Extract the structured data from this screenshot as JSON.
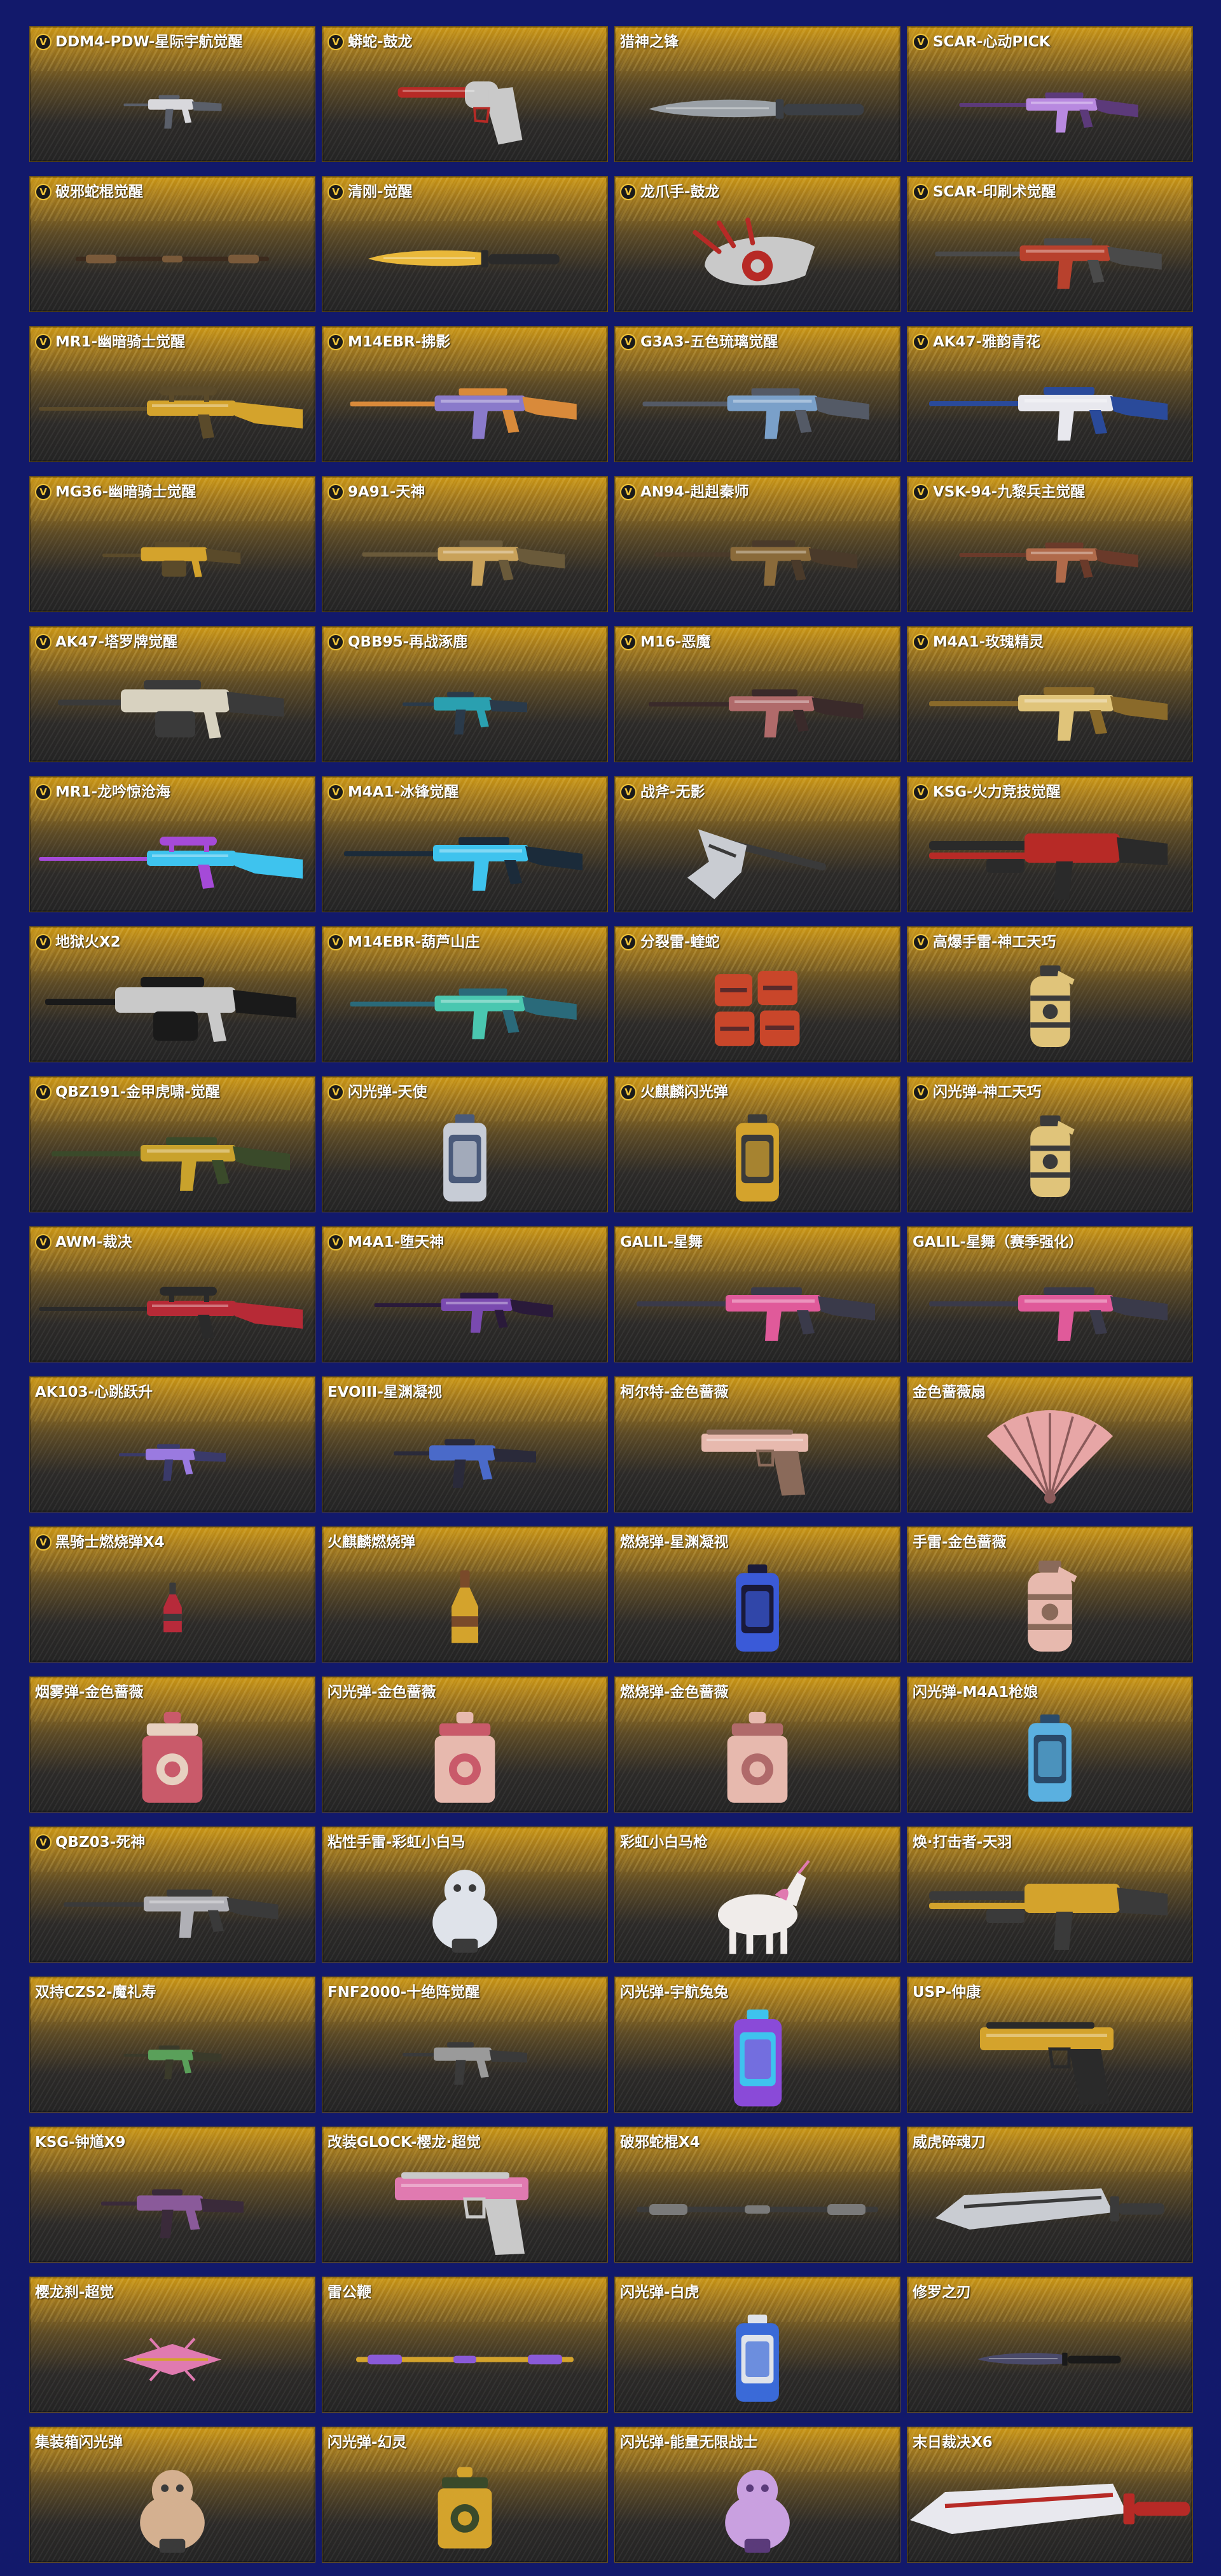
{
  "badge_label": "V",
  "items": [
    {
      "name": "DDM4-PDW-星际宇航觉醒",
      "v": true,
      "icon": "smg-icon",
      "c1": "#d8d8dc",
      "c2": "#5a5f6a",
      "s": 0.55
    },
    {
      "name": "蟒蛇-鼓龙",
      "v": true,
      "icon": "revolver-icon",
      "c1": "#b72a26",
      "c2": "#c9c9c9",
      "s": 0.8
    },
    {
      "name": "猎神之锋",
      "v": false,
      "icon": "knife-icon",
      "c1": "#9aa0a6",
      "c2": "#3b3f45",
      "s": 0.9
    },
    {
      "name": "SCAR-心动PICK",
      "v": true,
      "icon": "rifle-icon",
      "c1": "#b889e0",
      "c2": "#5c3a7a",
      "s": 0.75
    },
    {
      "name": "破邪蛇棍觉醒",
      "v": true,
      "icon": "staff-icon",
      "c1": "#7a5a3a",
      "c2": "#3b2a1d",
      "s": 0.8
    },
    {
      "name": "清刚-觉醒",
      "v": true,
      "icon": "knife-icon",
      "c1": "#e9b83a",
      "c2": "#2a2a2a",
      "s": 0.8
    },
    {
      "name": "龙爪手-鼓龙",
      "v": true,
      "icon": "claw-icon",
      "c1": "#b72a26",
      "c2": "#c9c9c9",
      "s": 0.8
    },
    {
      "name": "SCAR-印刷术觉醒",
      "v": true,
      "icon": "rifle-icon",
      "c1": "#b8412d",
      "c2": "#4a4a4a",
      "s": 0.95
    },
    {
      "name": "MR1-幽暗骑士觉醒",
      "v": true,
      "icon": "sniper-icon",
      "c1": "#d4a32c",
      "c2": "#5a4a2a",
      "s": 1.0
    },
    {
      "name": "M14EBR-拂影",
      "v": true,
      "icon": "rifle-icon",
      "c1": "#8a7acb",
      "c2": "#d98a3a",
      "s": 0.95
    },
    {
      "name": "G3A3-五色琉璃觉醒",
      "v": true,
      "icon": "rifle-icon",
      "c1": "#7aa0c9",
      "c2": "#545a66",
      "s": 0.95
    },
    {
      "name": "AK47-雅韵青花",
      "v": true,
      "icon": "rifle-icon",
      "c1": "#e8e8ee",
      "c2": "#2a4a9a",
      "s": 1.0
    },
    {
      "name": "MG36-幽暗骑士觉醒",
      "v": true,
      "icon": "mg-icon",
      "c1": "#d4a32c",
      "c2": "#5a4a2a",
      "s": 0.55
    },
    {
      "name": "9A91-天神",
      "v": true,
      "icon": "rifle-icon",
      "c1": "#c9a25a",
      "c2": "#6a5a3a",
      "s": 0.85
    },
    {
      "name": "AN94-赳赳秦师",
      "v": true,
      "icon": "rifle-icon",
      "c1": "#8a6a3a",
      "c2": "#4a3a2a",
      "s": 0.85
    },
    {
      "name": "VSK-94-九黎兵主觉醒",
      "v": true,
      "icon": "rifle-icon",
      "c1": "#b06a4a",
      "c2": "#6a3a2a",
      "s": 0.75
    },
    {
      "name": "AK47-塔罗牌觉醒",
      "v": true,
      "icon": "mg-icon",
      "c1": "#d8d2c0",
      "c2": "#3a3a3a",
      "s": 0.9
    },
    {
      "name": "QBB95-再战涿鹿",
      "v": true,
      "icon": "smg-icon",
      "c1": "#2aa0b0",
      "c2": "#2a3a4a",
      "s": 0.7
    },
    {
      "name": "M16-恶魔",
      "v": true,
      "icon": "rifle-icon",
      "c1": "#b06a6a",
      "c2": "#3a2a2a",
      "s": 0.9
    },
    {
      "name": "M4A1-玫瑰精灵",
      "v": true,
      "icon": "rifle-icon",
      "c1": "#e0c47a",
      "c2": "#8a6a2a",
      "s": 1.0
    },
    {
      "name": "MR1-龙吟惊沧海",
      "v": true,
      "icon": "sniper-icon",
      "c1": "#3ec3ee",
      "c2": "#a54ad8",
      "s": 1.0
    },
    {
      "name": "M4A1-冰锋觉醒",
      "v": true,
      "icon": "rifle-icon",
      "c1": "#3ec3ee",
      "c2": "#1b2b3a",
      "s": 1.0
    },
    {
      "name": "战斧-无影",
      "v": true,
      "icon": "axe-icon",
      "c1": "#c9ccd2",
      "c2": "#3a3a3a",
      "s": 0.9
    },
    {
      "name": "KSG-火力竞技觉醒",
      "v": true,
      "icon": "shotgun-icon",
      "c1": "#b72a26",
      "c2": "#2a2a2a",
      "s": 1.0
    },
    {
      "name": "地狱火X2",
      "v": true,
      "icon": "mg-icon",
      "c1": "#c9c9c9",
      "c2": "#1a1a1a",
      "s": 1.0
    },
    {
      "name": "M14EBR-葫芦山庄",
      "v": true,
      "icon": "rifle-icon",
      "c1": "#4ac7b0",
      "c2": "#2a6a7a",
      "s": 0.95
    },
    {
      "name": "分裂雷-蝰蛇",
      "v": true,
      "icon": "cluster-grenade-icon",
      "c1": "#c9462a",
      "c2": "#5a2a2a",
      "s": 0.9
    },
    {
      "name": "高爆手雷-神工天巧",
      "v": true,
      "icon": "grenade-icon",
      "c1": "#e0c47a",
      "c2": "#3a3a3a",
      "s": 0.9
    },
    {
      "name": "QBZ191-金甲虎啸-觉醒",
      "v": true,
      "icon": "rifle-icon",
      "c1": "#c9a22c",
      "c2": "#3a4a2a",
      "s": 1.0
    },
    {
      "name": "闪光弹-天使",
      "v": true,
      "icon": "canister-icon",
      "c1": "#c7ccd6",
      "c2": "#4a5a7a",
      "s": 0.9
    },
    {
      "name": "火麒麟闪光弹",
      "v": true,
      "icon": "canister-icon",
      "c1": "#d4a32c",
      "c2": "#3a3a3a",
      "s": 0.9
    },
    {
      "name": "闪光弹-神工天巧",
      "v": true,
      "icon": "grenade-icon",
      "c1": "#e0c47a",
      "c2": "#3a3a3a",
      "s": 0.9
    },
    {
      "name": "AWM-裁决",
      "v": true,
      "icon": "sniper-icon",
      "c1": "#b72a36",
      "c2": "#2a2a2a",
      "s": 1.0
    },
    {
      "name": "M4A1-堕天神",
      "v": true,
      "icon": "rifle-icon",
      "c1": "#7a4ab0",
      "c2": "#2a1a3a",
      "s": 0.75
    },
    {
      "name": "GALIL-星舞",
      "v": false,
      "icon": "rifle-icon",
      "c1": "#e05a9a",
      "c2": "#3a3a4a",
      "s": 1.0
    },
    {
      "name": "GALIL-星舞（赛季强化）",
      "v": false,
      "icon": "rifle-icon",
      "c1": "#e05a9a",
      "c2": "#3a3a4a",
      "s": 1.0
    },
    {
      "name": "AK103-心跳跃升",
      "v": false,
      "icon": "smg-icon",
      "c1": "#9a7ae0",
      "c2": "#3a3a6a",
      "s": 0.6
    },
    {
      "name": "EVOIII-星渊凝视",
      "v": false,
      "icon": "smg-icon",
      "c1": "#4a6ac9",
      "c2": "#2a2a3a",
      "s": 0.8
    },
    {
      "name": "柯尔特-金色蔷薇",
      "v": false,
      "icon": "pistol-icon",
      "c1": "#e7b9ae",
      "c2": "#8a6a5a",
      "s": 0.8
    },
    {
      "name": "金色蔷薇扇",
      "v": false,
      "icon": "fan-icon",
      "c1": "#e7a6a6",
      "c2": "#8a5a5a",
      "s": 0.9
    },
    {
      "name": "黑骑士燃烧弹X4",
      "v": true,
      "icon": "molotov-icon",
      "c1": "#b72a3a",
      "c2": "#3a3a3a",
      "s": 0.55
    },
    {
      "name": "火麒麟燃烧弹",
      "v": false,
      "icon": "molotov-icon",
      "c1": "#d4a32c",
      "c2": "#7a4a2a",
      "s": 0.8
    },
    {
      "name": "燃烧弹-星渊凝视",
      "v": false,
      "icon": "canister-icon",
      "c1": "#3a5ad8",
      "c2": "#1a1a3a",
      "s": 0.9
    },
    {
      "name": "手雷-金色蔷薇",
      "v": false,
      "icon": "grenade-icon",
      "c1": "#e7b9ae",
      "c2": "#8a6a5a",
      "s": 1.0
    },
    {
      "name": "烟雾弹-金色蔷薇",
      "v": false,
      "icon": "lantern-icon",
      "c1": "#c95a6a",
      "c2": "#e7d0c0",
      "s": 0.95
    },
    {
      "name": "闪光弹-金色蔷薇",
      "v": false,
      "icon": "lantern-icon",
      "c1": "#e7b9ae",
      "c2": "#c95a6a",
      "s": 0.95
    },
    {
      "name": "燃烧弹-金色蔷薇",
      "v": false,
      "icon": "lantern-icon",
      "c1": "#e7b9ae",
      "c2": "#b06a6a",
      "s": 0.95
    },
    {
      "name": "闪光弹-M4A1枪娘",
      "v": false,
      "icon": "canister-icon",
      "c1": "#5ab0e0",
      "c2": "#2a4a6a",
      "s": 0.9
    },
    {
      "name": "QBZ03-死神",
      "v": true,
      "icon": "rifle-icon",
      "c1": "#b0b0b6",
      "c2": "#3a3a3a",
      "s": 0.9
    },
    {
      "name": "粘性手雷-彩虹小白马",
      "v": false,
      "icon": "mascot-icon",
      "c1": "#dfe3ea",
      "c2": "#3a3a3a",
      "s": 0.9
    },
    {
      "name": "彩虹小白马枪",
      "v": false,
      "icon": "unicorn-icon",
      "c1": "#f0ecea",
      "c2": "#e07ab0",
      "s": 0.95
    },
    {
      "name": "焕·打击者-天羽",
      "v": false,
      "icon": "shotgun-icon",
      "c1": "#d4a32c",
      "c2": "#3a3a3a",
      "s": 1.0
    },
    {
      "name": "双持CZS2-魔礼寿",
      "v": false,
      "icon": "smg-icon",
      "c1": "#5aa05a",
      "c2": "#3a3a2a",
      "s": 0.55
    },
    {
      "name": "FNF2000-十绝阵觉醒",
      "v": false,
      "icon": "smg-icon",
      "c1": "#9a9a9a",
      "c2": "#3a3a3a",
      "s": 0.7
    },
    {
      "name": "闪光弹-宇航兔兔",
      "v": false,
      "icon": "canister-icon",
      "c1": "#8a4ad8",
      "c2": "#3ec3ee",
      "s": 1.0
    },
    {
      "name": "USP-仲康",
      "v": false,
      "icon": "pistol-icon",
      "c1": "#d4a32c",
      "c2": "#2a2a2a",
      "s": 1.0
    },
    {
      "name": "KSG-钟馗X9",
      "v": false,
      "icon": "smg-icon",
      "c1": "#8a5a9a",
      "c2": "#3a2a3a",
      "s": 0.8
    },
    {
      "name": "改装GLOCK-樱龙·超觉",
      "v": false,
      "icon": "pistol-icon",
      "c1": "#e07ab0",
      "c2": "#c9c9c9",
      "s": 1.0
    },
    {
      "name": "破邪蛇棍X4",
      "v": false,
      "icon": "staff-icon",
      "c1": "#7a7a7a",
      "c2": "#3a3a3a",
      "s": 1.0
    },
    {
      "name": "威虎碎魂刀",
      "v": false,
      "icon": "blade-icon",
      "c1": "#c9ccd2",
      "c2": "#3a3a3a",
      "s": 0.9
    },
    {
      "name": "樱龙刹-超觉",
      "v": false,
      "icon": "dart-icon",
      "c1": "#e07ab0",
      "c2": "#d4a32c",
      "s": 0.7
    },
    {
      "name": "雷公鞭",
      "v": false,
      "icon": "staff-icon",
      "c1": "#8a5ad8",
      "c2": "#d4a32c",
      "s": 0.9
    },
    {
      "name": "闪光弹-白虎",
      "v": false,
      "icon": "canister-icon",
      "c1": "#3a6ad8",
      "c2": "#dfe3ea",
      "s": 0.9
    },
    {
      "name": "修罗之刃",
      "v": false,
      "icon": "knife-icon",
      "c1": "#4a4a6a",
      "c2": "#1a1a1a",
      "s": 0.6
    },
    {
      "name": "集装箱闪光弹",
      "v": false,
      "icon": "mascot-icon",
      "c1": "#d4b090",
      "c2": "#3a3a3a",
      "s": 0.9
    },
    {
      "name": "闪光弹-幻灵",
      "v": false,
      "icon": "lantern-icon",
      "c1": "#d4a32c",
      "c2": "#3a4a2a",
      "s": 0.85
    },
    {
      "name": "闪光弹-能量无限战士",
      "v": false,
      "icon": "mascot-icon",
      "c1": "#c9a0e0",
      "c2": "#5a3a7a",
      "s": 0.9
    },
    {
      "name": "末日裁决X6",
      "v": false,
      "icon": "blade-icon",
      "c1": "#e8e8ee",
      "c2": "#b72a26",
      "s": 1.1
    }
  ]
}
